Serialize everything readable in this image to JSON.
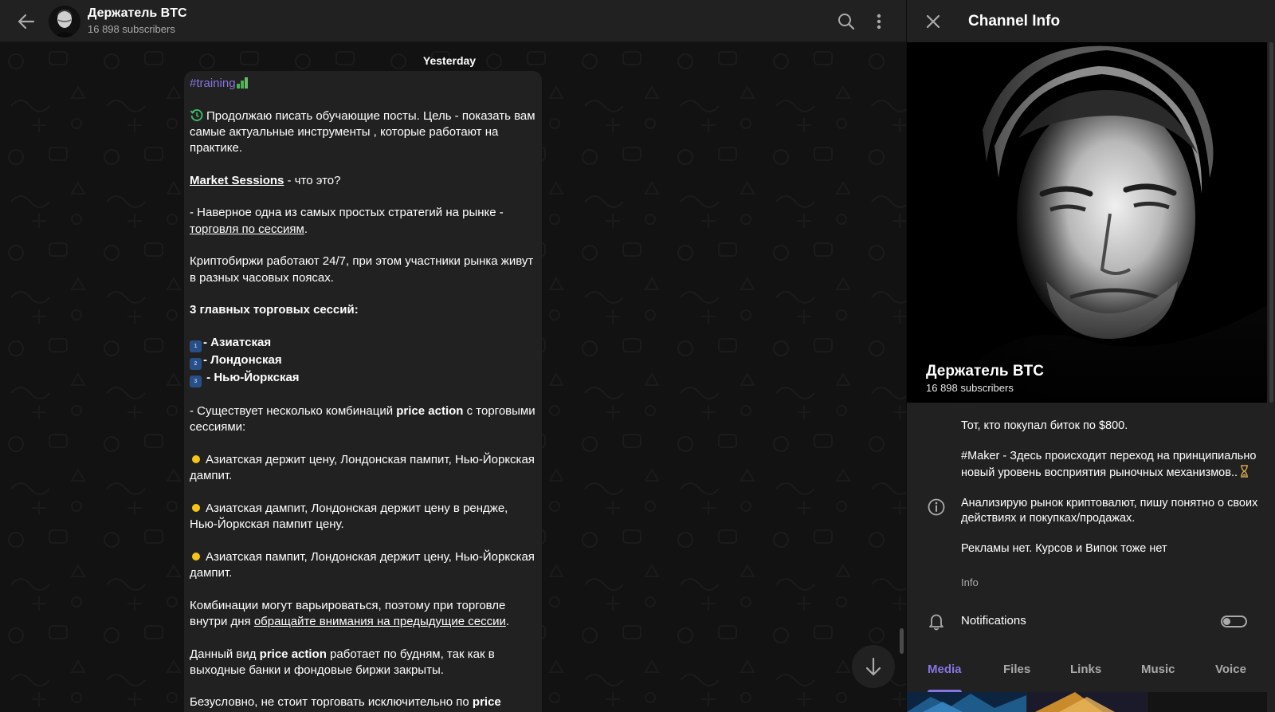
{
  "chat": {
    "title": "Держатель BTC",
    "subtitle": "16 898 subscribers",
    "date_separator": "Yesterday"
  },
  "message": {
    "hashtag": "#training",
    "intro": "Продолжаю писать обучающие посты. Цель - показать вам самые актуальные инструменты , которые работают на практике.",
    "ms_link": "Market Sessions",
    "ms_rest": " - что это?",
    "p2_a": "- Наверное одна из самых простых стратегий на рынке - ",
    "p2_link": "торговля по сессиям",
    "p2_b": ".",
    "p3": "Криптобиржи работают 24/7, при этом участники рынка живут в разных часовых поясах.",
    "p4": "3 главных торговых сессий:",
    "sessions": [
      {
        "num": "1",
        "text": "- Азиатская"
      },
      {
        "num": "2",
        "text": "- Лондонская"
      },
      {
        "num": "3",
        "text": " - Нью-Йоркская"
      }
    ],
    "p5_a": "- Существует несколько комбинаций ",
    "p5_bold": "price action",
    "p5_b": " с торговыми сессиями:",
    "combos": [
      "Азиатская держит цену, Лондонская пампит, Нью-Йоркская дампит.",
      "Азиатская дампит, Лондонская держит цену в рендже, Нью-Йоркская пампит цену.",
      "Азиатская пампит, Лондонская держит цену, Нью-Йоркская дампит."
    ],
    "p6_a": "Комбинации могут варьироваться, поэтому при торговле внутри дня ",
    "p6_link": "обращайте внимания на предыдущие сессии",
    "p6_b": ".",
    "p7_a": "Данный вид ",
    "p7_bold": "price action",
    "p7_b": " работает по будням, так как в выходные банки и фондовые биржи закрыты.",
    "p8_a": "Безусловно, не стоит торговать исключительно по ",
    "p8_bold": "price action"
  },
  "info": {
    "title": "Channel Info",
    "name": "Держатель BTC",
    "subscribers": "16 898 subscribers",
    "about": [
      "Тот, кто покупал биток по $800.",
      "#Maker - Здесь происходит переход на принципиально новый уровень восприятия рыночных механизмов..",
      "Анализирую рынок криптовалют, пишу понятно о своих действиях и покупках/продажах.",
      "Рекламы нет. Курсов и Випок тоже нет"
    ],
    "about_caption": "Info",
    "notifications_label": "Notifications",
    "notifications_on": false,
    "tabs": [
      "Media",
      "Files",
      "Links",
      "Music",
      "Voice"
    ],
    "active_tab": "Media"
  },
  "icons": {
    "back": "arrow-left-icon",
    "search": "search-icon",
    "more": "more-vertical-icon",
    "close": "close-icon",
    "info": "info-icon",
    "bell": "bell-icon",
    "scroll_down": "arrow-down-icon"
  },
  "colors": {
    "accent": "#8774e1",
    "bubble": "#212121",
    "panel": "#212121",
    "chat_bg": "#121212",
    "bullet": "#f5c518",
    "muted": "#aaaaaa"
  }
}
